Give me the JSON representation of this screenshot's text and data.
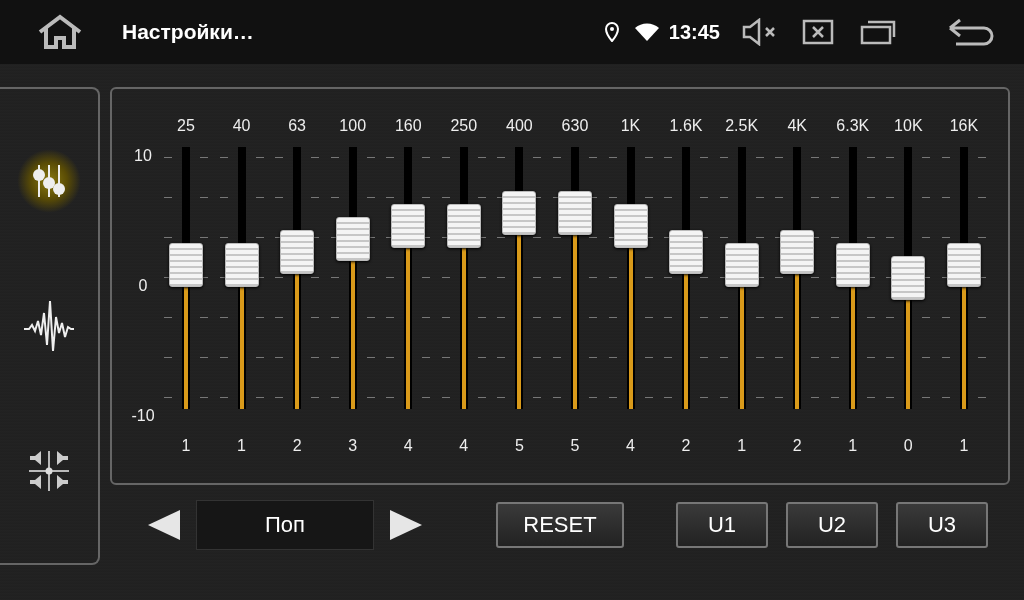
{
  "status_bar": {
    "title": "Настройки…",
    "time": "13:45"
  },
  "sidebar": {
    "items": [
      {
        "kind": "equalizer",
        "selected": true
      },
      {
        "kind": "sound-wave",
        "selected": false
      },
      {
        "kind": "speakers",
        "selected": false
      }
    ]
  },
  "equalizer": {
    "scale": [
      "10",
      "0",
      "-10"
    ],
    "bands": [
      {
        "frequency": "25",
        "level": 0.55,
        "value": "1"
      },
      {
        "frequency": "40",
        "level": 0.55,
        "value": "1"
      },
      {
        "frequency": "63",
        "level": 0.6,
        "value": "2"
      },
      {
        "frequency": "100",
        "level": 0.65,
        "value": "3"
      },
      {
        "frequency": "160",
        "level": 0.7,
        "value": "4"
      },
      {
        "frequency": "250",
        "level": 0.7,
        "value": "4"
      },
      {
        "frequency": "400",
        "level": 0.75,
        "value": "5"
      },
      {
        "frequency": "630",
        "level": 0.75,
        "value": "5"
      },
      {
        "frequency": "1K",
        "level": 0.7,
        "value": "4"
      },
      {
        "frequency": "1.6K",
        "level": 0.6,
        "value": "2"
      },
      {
        "frequency": "2.5K",
        "level": 0.55,
        "value": "1"
      },
      {
        "frequency": "4K",
        "level": 0.6,
        "value": "2"
      },
      {
        "frequency": "6.3K",
        "level": 0.55,
        "value": "1"
      },
      {
        "frequency": "10K",
        "level": 0.5,
        "value": "0"
      },
      {
        "frequency": "16K",
        "level": 0.55,
        "value": "1"
      }
    ]
  },
  "preset": {
    "name": "Поп"
  },
  "buttons": {
    "reset": "RESET",
    "user_presets": [
      "U1",
      "U2",
      "U3"
    ]
  }
}
